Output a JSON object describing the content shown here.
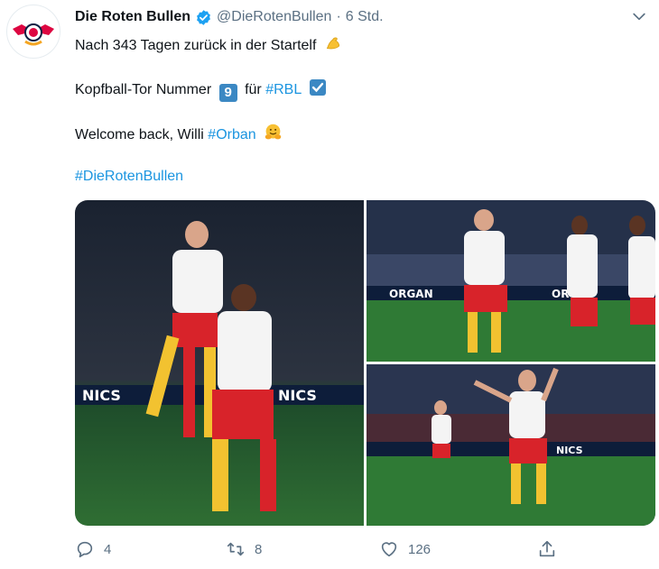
{
  "tweet": {
    "author_name": "Die Roten Bullen",
    "handle": "@DieRotenBullen",
    "separator": "·",
    "time": "6 Std.",
    "lines": [
      {
        "text": "Nach 343 Tagen zurück in der Startelf",
        "emoji": "flexed-biceps"
      },
      {
        "pre": "Kopfball-Tor Nummer",
        "number_emoji": "9",
        "mid": "für",
        "tag": "#RBL",
        "emoji": "check-box"
      },
      {
        "pre": "Welcome back, Willi",
        "tag": "#Orban",
        "emoji": "hugging-face"
      },
      {
        "tag": "#DieRotenBullen"
      }
    ],
    "media": [
      {
        "desc": "player-celebrating-with-teammate"
      },
      {
        "desc": "players-celebrating-goal"
      },
      {
        "desc": "player-running-celebration"
      }
    ],
    "actions": {
      "replies": "4",
      "retweets": "8",
      "likes": "126"
    },
    "colors": {
      "text": "#0f1419",
      "muted": "#5b7083",
      "link": "#1b95e0",
      "verified": "#1da1f2",
      "brand_red": "#dd0741"
    }
  }
}
